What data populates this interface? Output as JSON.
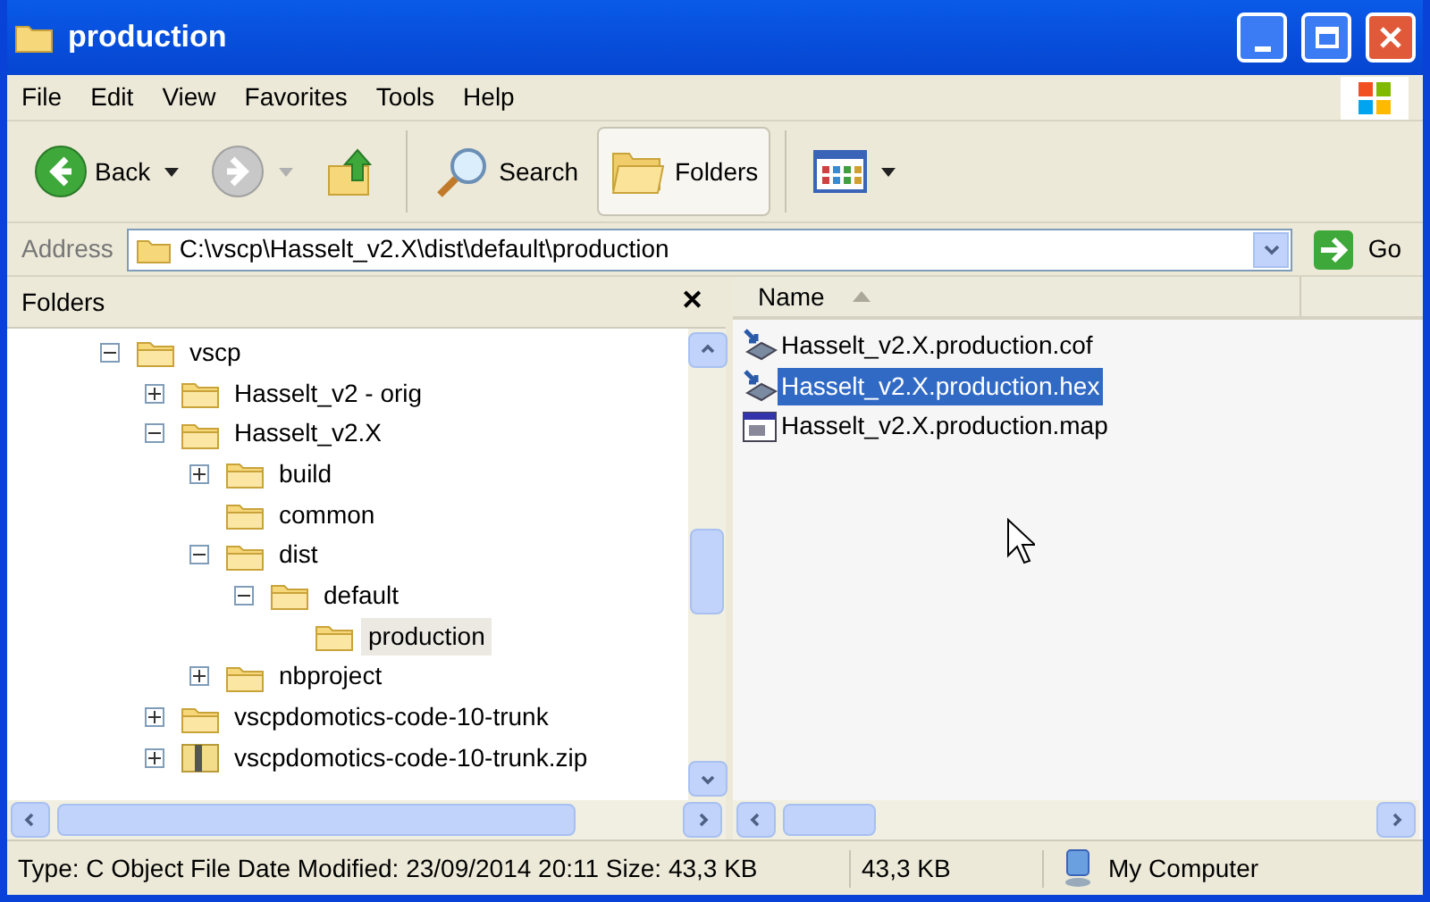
{
  "window": {
    "title": "production"
  },
  "menu": [
    "File",
    "Edit",
    "View",
    "Favorites",
    "Tools",
    "Help"
  ],
  "toolbar": [
    {
      "kind": "back",
      "label": "Back",
      "disabled": false
    },
    {
      "kind": "forward",
      "disabled": true
    },
    {
      "kind": "up"
    },
    {
      "kind": "search",
      "label": "Search"
    },
    {
      "kind": "folders",
      "label": "Folders",
      "selected": true
    },
    {
      "kind": "views"
    }
  ],
  "address": {
    "label": "Address",
    "value": "C:\\vscp\\Hasselt_v2.X\\dist\\default\\production",
    "go": "Go"
  },
  "folders_pane": {
    "title": "Folders",
    "close": "✕",
    "tree": [
      {
        "label": "vscp",
        "kind": "folder",
        "expanded": true,
        "selected": false,
        "children": [
          {
            "label": "Hasselt_v2 - orig",
            "kind": "folder",
            "expanded": false,
            "selected": false
          },
          {
            "label": "Hasselt_v2.X",
            "kind": "folder",
            "expanded": true,
            "selected": false,
            "children": [
              {
                "label": "build",
                "kind": "folder",
                "expanded": false,
                "selected": false
              },
              {
                "label": "common",
                "kind": "folder",
                "selected": false
              },
              {
                "label": "dist",
                "kind": "folder",
                "expanded": true,
                "selected": false,
                "children": [
                  {
                    "label": "default",
                    "kind": "folder",
                    "expanded": true,
                    "selected": false,
                    "children": [
                      {
                        "label": "production",
                        "kind": "folder",
                        "selected": true
                      }
                    ]
                  }
                ]
              },
              {
                "label": "nbproject",
                "kind": "folder",
                "expanded": false,
                "selected": false
              }
            ]
          },
          {
            "label": "vscpdomotics-code-10-trunk",
            "kind": "folder",
            "expanded": false,
            "selected": false
          },
          {
            "label": "vscpdomotics-code-10-trunk.zip",
            "kind": "zip",
            "expanded": false,
            "selected": false
          }
        ]
      }
    ]
  },
  "file_list": {
    "column": "Name",
    "files": [
      {
        "name": "Hasselt_v2.X.production.cof",
        "kind": "program",
        "selected": false
      },
      {
        "name": "Hasselt_v2.X.production.hex",
        "kind": "program",
        "selected": true
      },
      {
        "name": "Hasselt_v2.X.production.map",
        "kind": "map",
        "selected": false
      }
    ]
  },
  "status_bar": {
    "details": "Type: C Object File Date Modified: 23/09/2014 20:11 Size: 43,3 KB",
    "size": "43,3 KB",
    "zone": "My Computer"
  }
}
